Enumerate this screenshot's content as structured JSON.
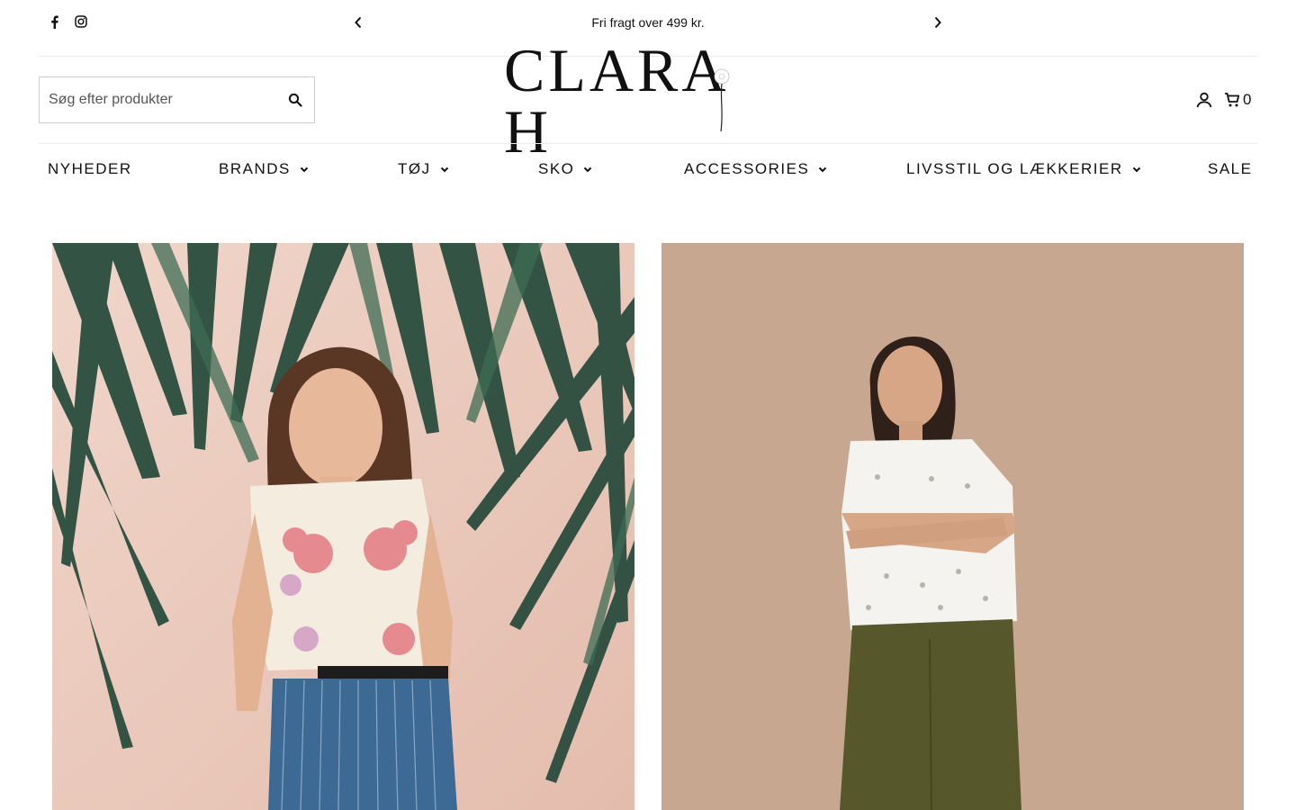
{
  "announcement": {
    "text": "Fri fragt over 499 kr."
  },
  "social": {
    "icons": [
      "facebook-icon",
      "instagram-icon"
    ]
  },
  "search": {
    "placeholder": "Søg efter produkter",
    "value": ""
  },
  "logo": {
    "text": "CLARA H"
  },
  "cart": {
    "count": "0"
  },
  "nav": {
    "items": [
      {
        "label": "NYHEDER",
        "has_dropdown": false
      },
      {
        "label": "BRANDS",
        "has_dropdown": true
      },
      {
        "label": "TØJ",
        "has_dropdown": true
      },
      {
        "label": "SKO",
        "has_dropdown": true
      },
      {
        "label": "ACCESSORIES",
        "has_dropdown": true
      },
      {
        "label": "LIVSSTIL OG LÆKKERIER",
        "has_dropdown": true
      },
      {
        "label": "SALE",
        "has_dropdown": false
      }
    ]
  },
  "colors": {
    "text": "#111111",
    "divider": "#ececec",
    "left_backdrop": "#e9c8bb",
    "right_backdrop": "#c6a68e"
  }
}
